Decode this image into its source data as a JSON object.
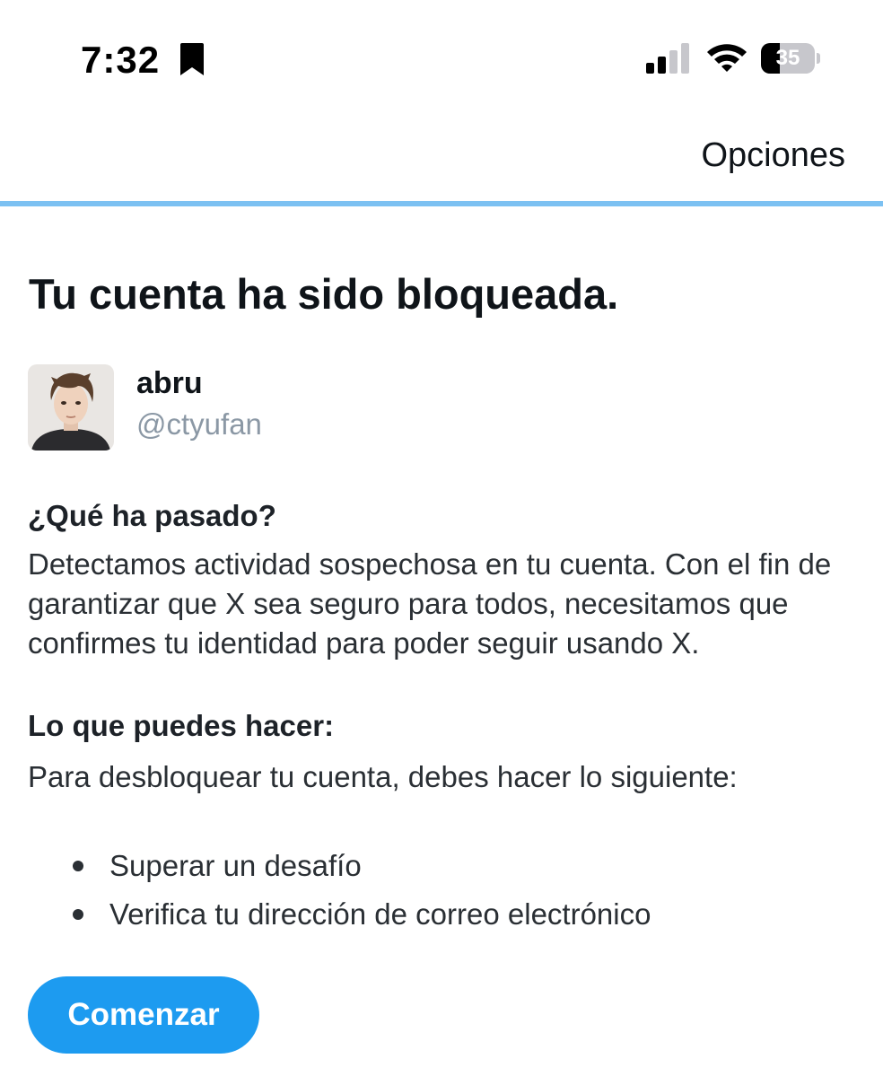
{
  "status_bar": {
    "time": "7:32",
    "battery_level": "35",
    "battery_fraction": 0.35,
    "icons": [
      "bookmark-icon",
      "cellular-signal-icon",
      "wifi-icon",
      "battery-icon"
    ]
  },
  "nav": {
    "options_label": "Opciones",
    "progress_color": "#7cc1f2"
  },
  "page": {
    "title": "Tu cuenta ha sido bloqueada."
  },
  "user": {
    "name": "abru",
    "handle": "@ctyufan"
  },
  "what_happened": {
    "heading": "¿Qué ha pasado?",
    "body": "Detectamos actividad sospechosa en tu cuenta. Con el fin de garantizar que X sea seguro para todos, necesitamos que confirmes tu identidad para poder seguir usando X."
  },
  "what_you_can_do": {
    "heading": "Lo que puedes hacer:",
    "body": "Para desbloquear tu cuenta, debes hacer lo siguiente:",
    "steps": [
      "Superar un desafío",
      "Verifica tu dirección de correo electrónico"
    ]
  },
  "actions": {
    "start_label": "Comenzar",
    "accent_color": "#1d9bf0"
  }
}
